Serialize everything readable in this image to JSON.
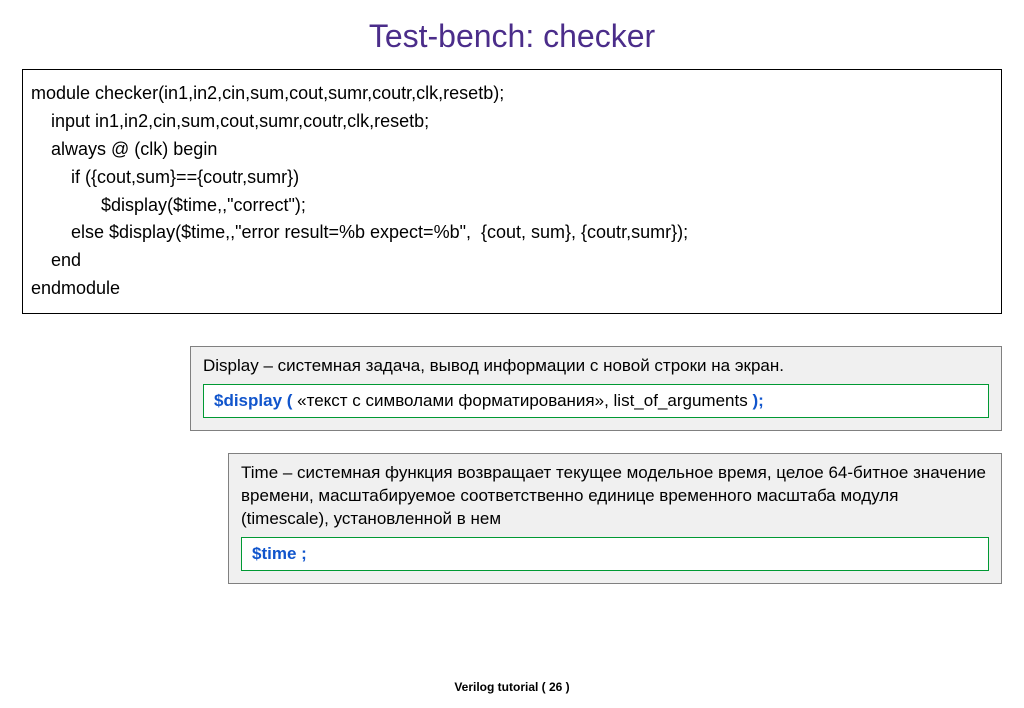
{
  "title": "Test-bench: checker",
  "code": {
    "l1": "module checker(in1,in2,cin,sum,cout,sumr,coutr,clk,resetb);",
    "l2": "    input in1,in2,cin,sum,cout,sumr,coutr,clk,resetb;",
    "l3": "    always @ (clk) begin",
    "l4": "        if ({cout,sum}=={coutr,sumr})",
    "l5": "              $display($time,,\"correct\");",
    "l6": "        else $display($time,,\"error result=%b expect=%b\",  {cout, sum}, {coutr,sumr});",
    "l7": "    end",
    "l8": "endmodule"
  },
  "note1": {
    "text": "Display – системная задача, вывод информации с новой строки на экран.",
    "syntax_kw": "$display ( ",
    "syntax_body": "«текст с символами форматирования», list_of_arguments ",
    "syntax_end": ");"
  },
  "note2": {
    "text": "Time – системная функция возвращает текущее модельное время, целое 64-битное значение времени, масштабируемое соответственно единице временного масштаба модуля (timescale), установленной в нем",
    "syntax_kw": "$time ;"
  },
  "footer": "Verilog tutorial  ( 26 )"
}
